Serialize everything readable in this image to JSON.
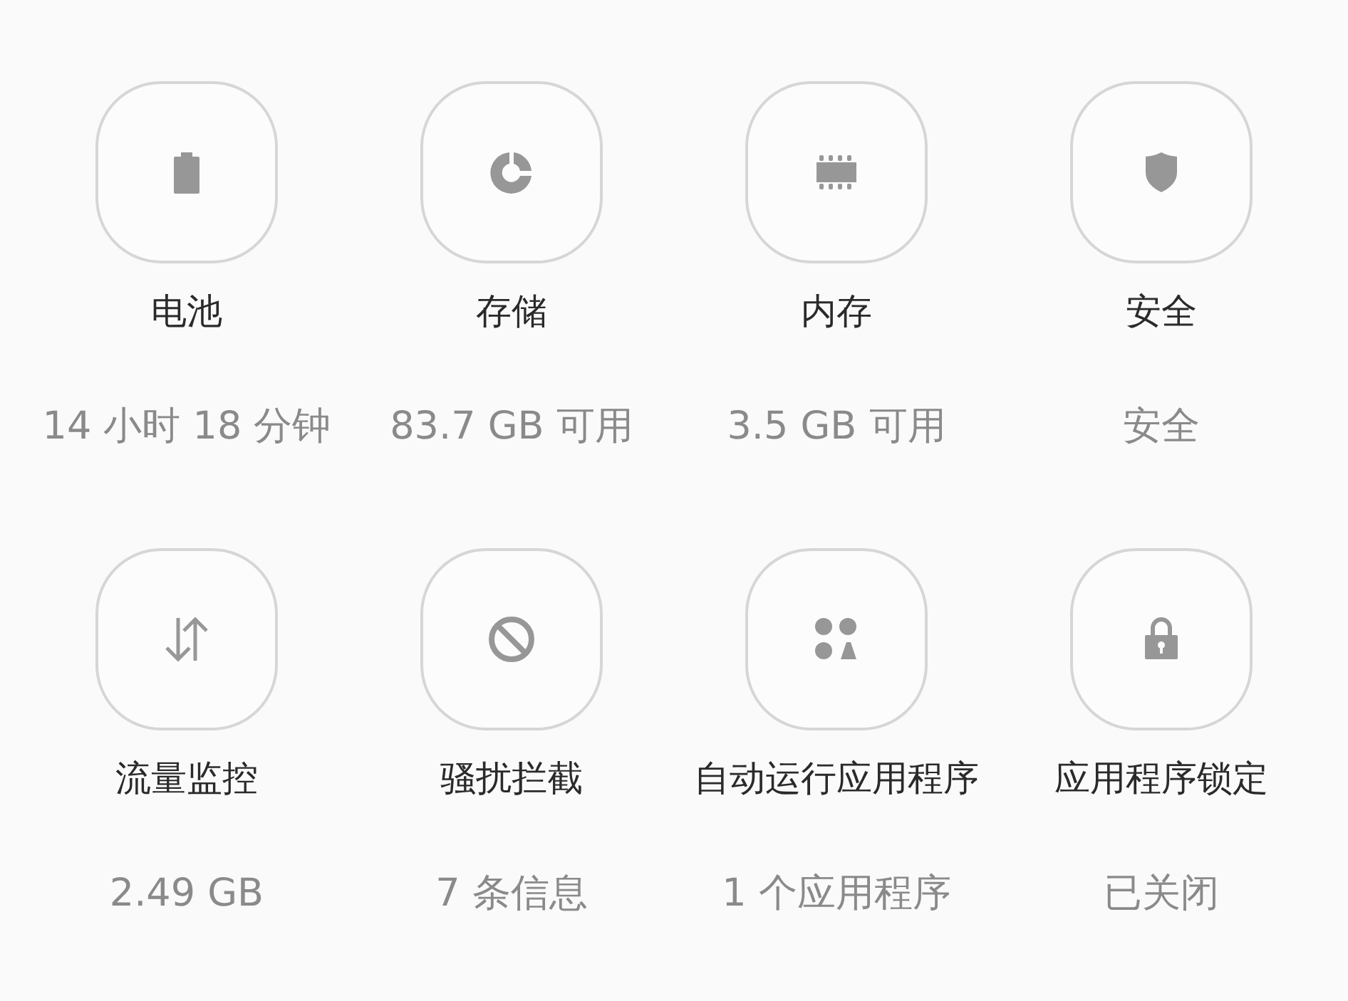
{
  "tiles": [
    {
      "kind": "battery",
      "label": "电池",
      "value": "14 小时 18 分钟"
    },
    {
      "kind": "storage",
      "label": "存储",
      "value": "83.7 GB 可用"
    },
    {
      "kind": "memory",
      "label": "内存",
      "value": "3.5 GB 可用"
    },
    {
      "kind": "security",
      "label": "安全",
      "value": "安全"
    },
    {
      "kind": "data",
      "label": "流量监控",
      "value": "2.49 GB"
    },
    {
      "kind": "block",
      "label": "骚扰拦截",
      "value": "7 条信息"
    },
    {
      "kind": "apps",
      "label": "自动运行应用程序",
      "value": "1 个应用程序"
    },
    {
      "kind": "lock",
      "label": "应用程序锁定",
      "value": "已关闭"
    }
  ]
}
